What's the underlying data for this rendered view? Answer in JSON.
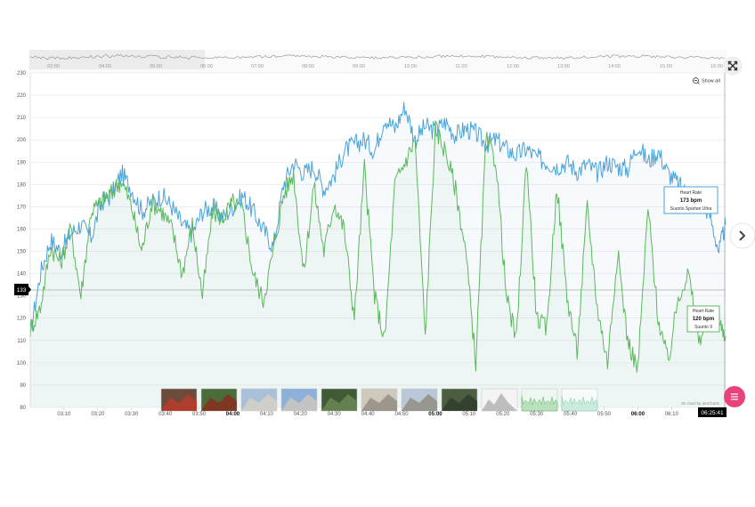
{
  "chart_data": {
    "type": "line",
    "ylim": [
      80,
      230
    ],
    "y_ticks": [
      "230",
      "220",
      "210",
      "200",
      "190",
      "180",
      "170",
      "160",
      "150",
      "140",
      "130",
      "120",
      "110",
      "100",
      "90",
      "80"
    ],
    "x_ticks": [
      {
        "label": "03:10",
        "bold": false
      },
      {
        "label": "03:20",
        "bold": false
      },
      {
        "label": "03:30",
        "bold": false
      },
      {
        "label": "03:40",
        "bold": false
      },
      {
        "label": "03:50",
        "bold": false
      },
      {
        "label": "04:00",
        "bold": true
      },
      {
        "label": "04:10",
        "bold": false
      },
      {
        "label": "04:20",
        "bold": false
      },
      {
        "label": "04:30",
        "bold": false
      },
      {
        "label": "04:40",
        "bold": false
      },
      {
        "label": "04:50",
        "bold": false
      },
      {
        "label": "05:00",
        "bold": true
      },
      {
        "label": "05:10",
        "bold": false
      },
      {
        "label": "05:20",
        "bold": false
      },
      {
        "label": "05:30",
        "bold": false
      },
      {
        "label": "05:40",
        "bold": false
      },
      {
        "label": "05:50",
        "bold": false
      },
      {
        "label": "06:00",
        "bold": true
      },
      {
        "label": "06:10",
        "bold": false
      }
    ],
    "overview_ticks": [
      "02:00",
      "04:00",
      "05:00",
      "06:00",
      "07:00",
      "08:00",
      "09:00",
      "10:00",
      "11:00",
      "12:00",
      "13:00",
      "14:00",
      "15:00",
      "16:00"
    ],
    "x_range_minutes": [
      180,
      386
    ],
    "series": [
      {
        "device": "Suunto Spartan Ultra",
        "color": "#4aa3d8",
        "x": [
          180,
          183,
          186,
          189,
          192,
          195,
          198,
          201,
          204,
          207,
          210,
          213,
          216,
          219,
          222,
          225,
          228,
          231,
          234,
          237,
          240,
          243,
          246,
          249,
          252,
          255,
          258,
          261,
          264,
          267,
          270,
          273,
          276,
          279,
          282,
          285,
          288,
          291,
          294,
          297,
          300,
          303,
          306,
          309,
          312,
          315,
          318,
          321,
          324,
          327,
          330,
          333,
          336,
          339,
          342,
          345,
          348,
          351,
          354,
          357,
          360,
          363,
          366,
          369,
          372,
          375,
          378,
          381,
          384,
          386
        ],
        "y": [
          113,
          140,
          155,
          150,
          158,
          162,
          156,
          172,
          175,
          185,
          178,
          168,
          172,
          175,
          170,
          162,
          158,
          168,
          170,
          165,
          170,
          175,
          168,
          160,
          152,
          180,
          190,
          185,
          188,
          178,
          184,
          195,
          198,
          200,
          195,
          210,
          205,
          215,
          200,
          206,
          204,
          208,
          202,
          205,
          203,
          198,
          200,
          196,
          193,
          196,
          192,
          190,
          188,
          190,
          186,
          189,
          185,
          190,
          188,
          187,
          198,
          190,
          195,
          185,
          180,
          175,
          172,
          168,
          150,
          162
        ]
      },
      {
        "device": "Suunto 9",
        "color": "#5cb85c",
        "x": [
          180,
          183,
          186,
          189,
          192,
          195,
          198,
          201,
          204,
          207,
          210,
          213,
          216,
          219,
          222,
          225,
          228,
          231,
          234,
          237,
          240,
          243,
          246,
          249,
          252,
          255,
          258,
          261,
          264,
          267,
          270,
          273,
          276,
          279,
          282,
          285,
          288,
          291,
          294,
          297,
          300,
          303,
          306,
          309,
          312,
          315,
          318,
          321,
          324,
          327,
          330,
          333,
          336,
          339,
          342,
          345,
          348,
          351,
          354,
          357,
          360,
          363,
          366,
          369,
          372,
          375,
          378,
          381,
          384,
          386
        ],
        "y": [
          115,
          125,
          152,
          145,
          160,
          130,
          168,
          172,
          176,
          182,
          170,
          150,
          172,
          168,
          160,
          140,
          162,
          130,
          168,
          165,
          172,
          168,
          140,
          128,
          150,
          175,
          185,
          140,
          180,
          150,
          172,
          160,
          120,
          188,
          130,
          110,
          180,
          190,
          200,
          112,
          205,
          195,
          178,
          150,
          100,
          200,
          190,
          130,
          110,
          192,
          120,
          115,
          180,
          130,
          105,
          170,
          125,
          100,
          150,
          110,
          97,
          170,
          120,
          100,
          130,
          140,
          110,
          120,
          118,
          112
        ]
      }
    ],
    "tooltips": [
      {
        "title": "Heart Rate",
        "value": "173 bpm",
        "device": "Suunto Spartan Ultra",
        "color": "#4aa3d8"
      },
      {
        "title": "Heart Rate",
        "value": "120 bpm",
        "device": "Suunto 9",
        "color": "#5cb85c"
      }
    ],
    "cursor_y_value": "133",
    "cursor_time": "06:25:41",
    "show_all_label": "Show all",
    "credit": "JS chart by amCharts",
    "thumbnails": [
      {
        "kind": "photo-runners",
        "base": "#6b4c3b",
        "accent": "#c0392b"
      },
      {
        "kind": "photo-runner-forest",
        "base": "#4a6b3a",
        "accent": "#8b2a1a"
      },
      {
        "kind": "photo-rocky-sky",
        "base": "#a8c0d8",
        "accent": "#d8d2c6"
      },
      {
        "kind": "photo-rock-sky",
        "base": "#8cb0d8",
        "accent": "#cfc9bd"
      },
      {
        "kind": "photo-forest",
        "base": "#3f5a35",
        "accent": "#6d8a55"
      },
      {
        "kind": "photo-rocks",
        "base": "#cfc9bd",
        "accent": "#8f8a80"
      },
      {
        "kind": "photo-rocks-sky",
        "base": "#b9c8d6",
        "accent": "#8f8a80"
      },
      {
        "kind": "photo-terrain",
        "base": "#4c5e40",
        "accent": "#2e3a28"
      },
      {
        "kind": "elevation-profile",
        "base": "#f4f4f4",
        "accent": "#bdbdbd"
      },
      {
        "kind": "mini-chart",
        "base": "#eef6f2",
        "accent": "#5cb85c"
      },
      {
        "kind": "mini-chart",
        "base": "#f6faf8",
        "accent": "#7fcfa8"
      }
    ]
  },
  "controls": {
    "fullscreen_icon": "expand-arrows-icon",
    "zoom_icon": "zoom-out-icon",
    "next_icon": "chevron-right-icon",
    "menu_icon": "menu-lines-icon",
    "menu_color": "#e8437a"
  }
}
